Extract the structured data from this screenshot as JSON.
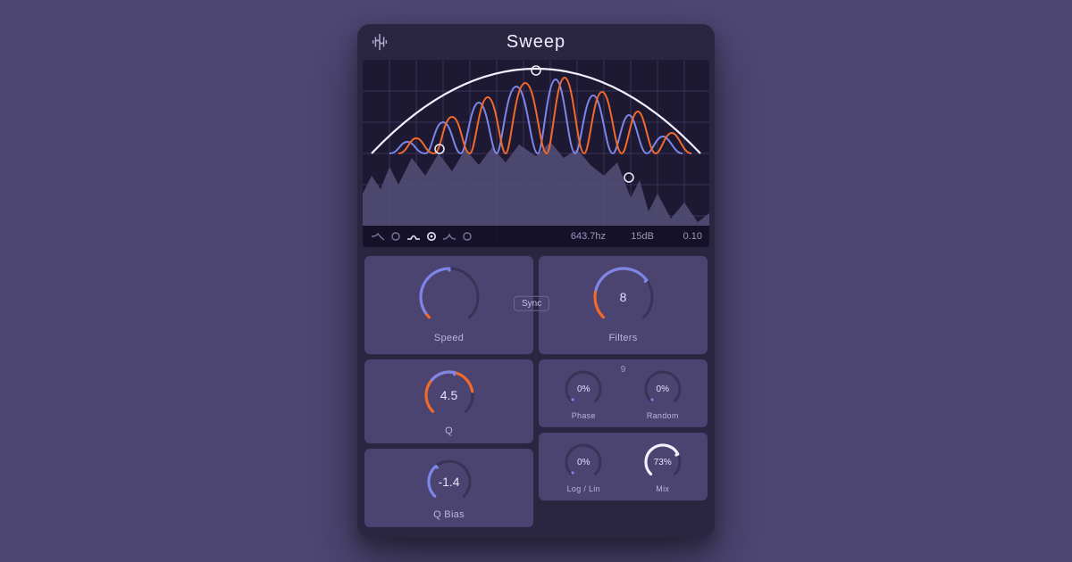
{
  "title": "Sweep",
  "logo_name": "brand-logo",
  "filter_modes": [
    {
      "name": "lowpass-icon",
      "active": false
    },
    {
      "name": "notch-icon",
      "active": false
    },
    {
      "name": "bandpass-icon",
      "active": true
    },
    {
      "name": "peak-icon",
      "active": true
    },
    {
      "name": "shelf-icon",
      "active": false
    },
    {
      "name": "highpass-icon",
      "active": false
    }
  ],
  "readout": {
    "freq": "643.7hz",
    "gain": "15dB",
    "q": "0.10"
  },
  "knobs": {
    "speed": {
      "label": "Speed",
      "value": "",
      "arc": 0.5,
      "accent": 0.1
    },
    "filters": {
      "label": "Filters",
      "value": "8",
      "arc": 0.7,
      "accent": 0.55
    },
    "q": {
      "label": "Q",
      "value": "4.5",
      "arc": 0.55,
      "accent": 0.8
    },
    "qbias": {
      "label": "Q Bias",
      "value": "-1.4",
      "arc": 0.35,
      "accent": 0.0
    },
    "phase": {
      "label": "Phase",
      "value": "0%",
      "arc": 0.0,
      "accent": 0.0
    },
    "random": {
      "label": "Random",
      "value": "0%",
      "arc": 0.0,
      "accent": 0.0
    },
    "loglin": {
      "label": "Log / Lin",
      "value": "0%",
      "arc": 0.0,
      "accent": 0.0
    },
    "mix": {
      "label": "Mix",
      "value": "73%",
      "arc": 0.73,
      "accent": 0.0,
      "white": true
    },
    "center_badge": "9"
  },
  "sync_label": "Sync",
  "colors": {
    "accent_orange": "#f26a2a",
    "accent_blue": "#7d86e8",
    "track": "#3a3356",
    "track_light": "#6a6294",
    "white": "#f4f0ff"
  }
}
